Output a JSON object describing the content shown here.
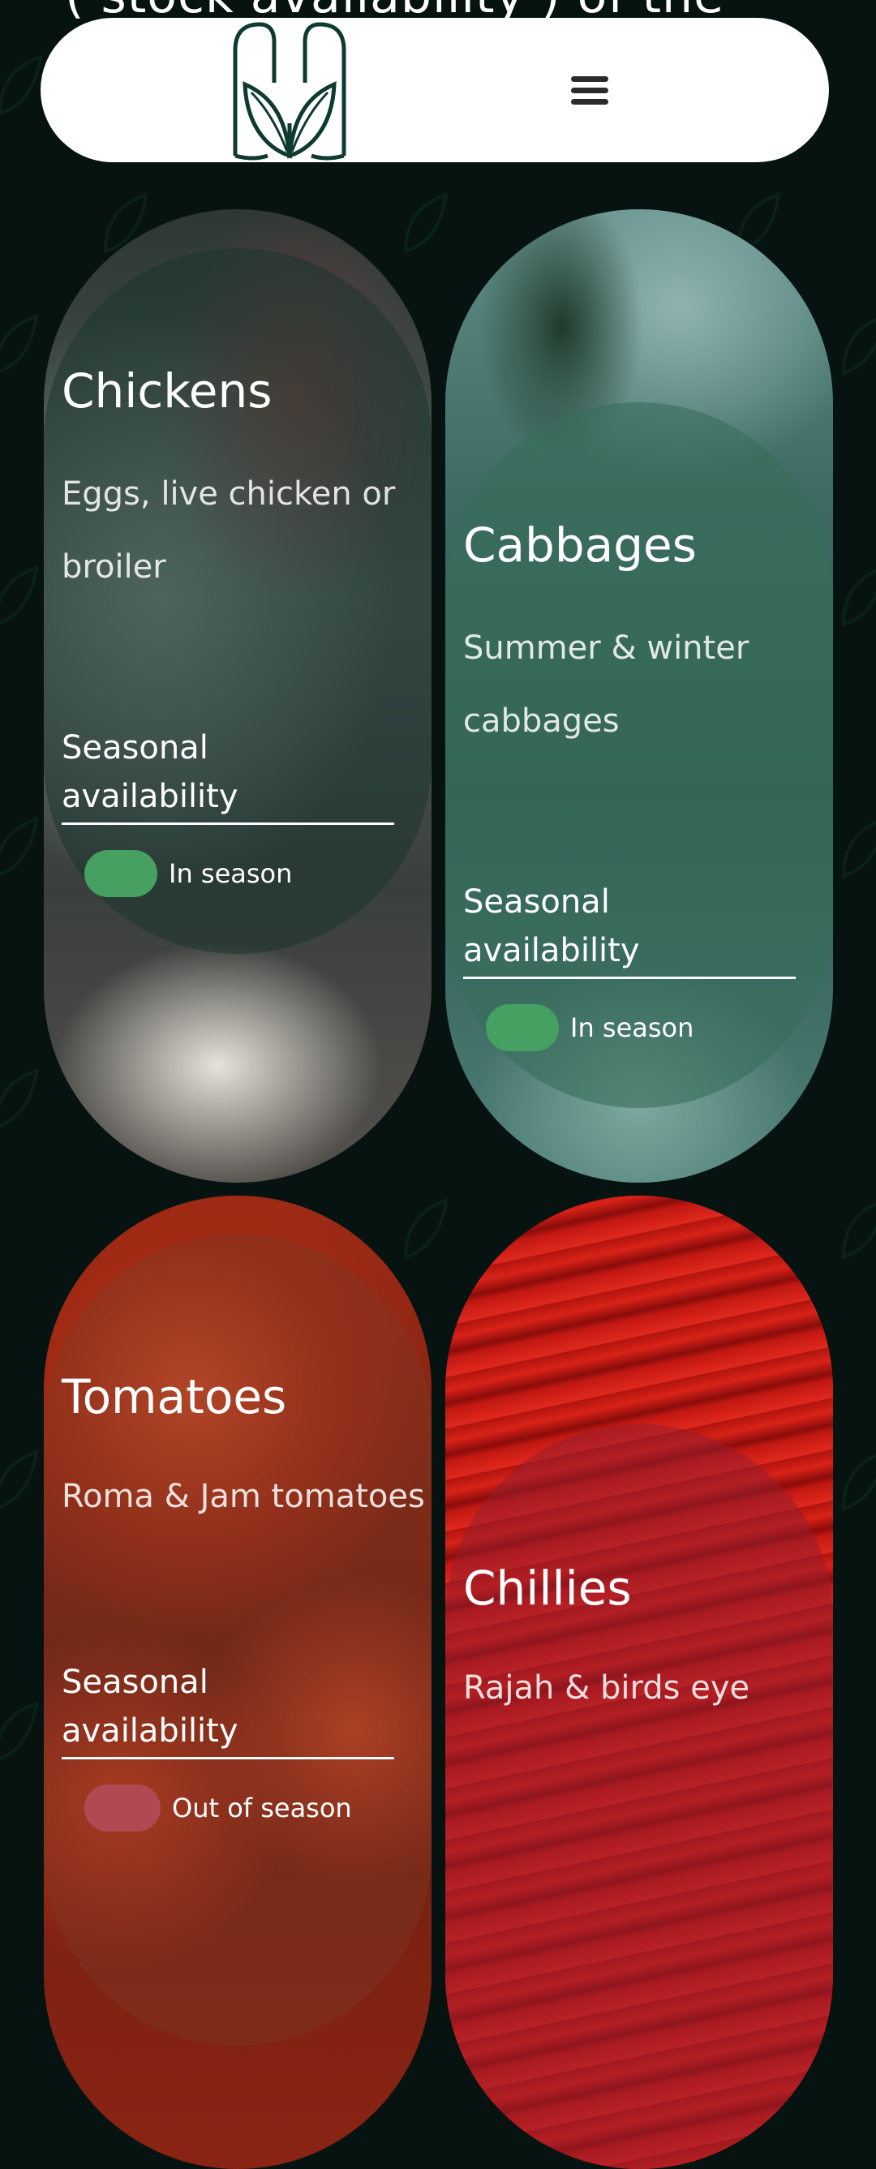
{
  "top_heading_partial": "( stock availability ) of the",
  "header": {
    "logo_icon": "leaf-logo-icon",
    "menu_icon": "hamburger-menu-icon"
  },
  "colors": {
    "background": "#061311",
    "in_season": "#46a062",
    "out_of_season": "#b04a52"
  },
  "products": [
    {
      "title": "Chickens",
      "description": "Eggs, live chicken or broiler",
      "seasonal_label": "Seasonal availability",
      "status": "In season"
    },
    {
      "title": "Cabbages",
      "description": "Summer & winter cabbages",
      "seasonal_label": "Seasonal availability",
      "status": "In season"
    },
    {
      "title": "Tomatoes",
      "description": "Roma & Jam tomatoes",
      "seasonal_label": "Seasonal availability",
      "status": "Out of season"
    },
    {
      "title": "Chillies",
      "description": "Rajah & birds eye"
    }
  ]
}
